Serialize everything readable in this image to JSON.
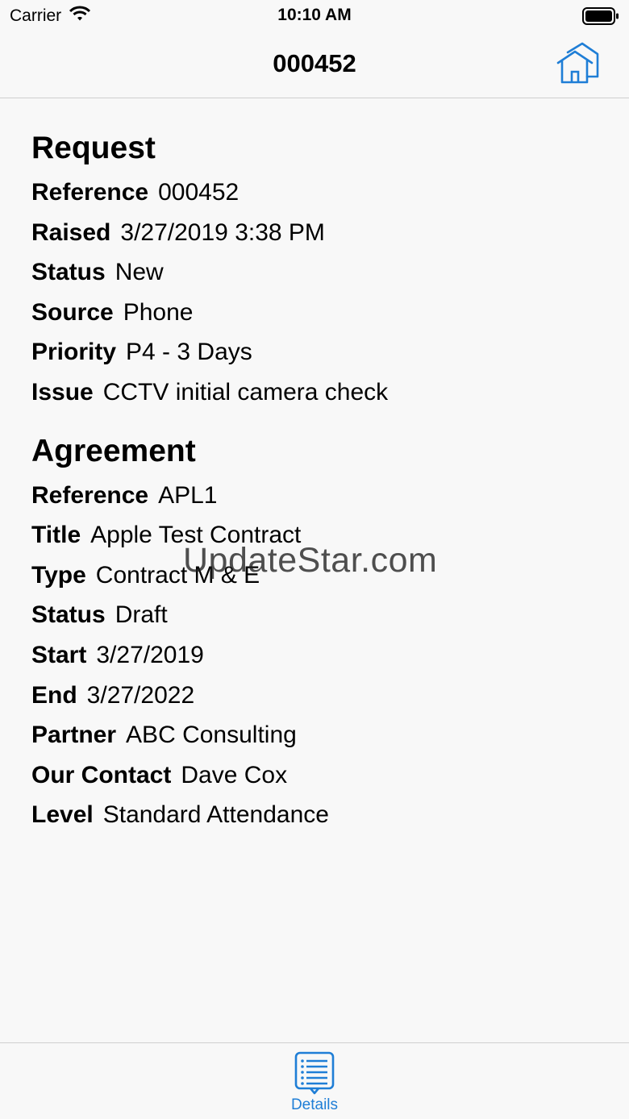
{
  "status_bar": {
    "carrier": "Carrier",
    "time": "10:10 AM"
  },
  "nav": {
    "title": "000452",
    "home_icon": "home-icon"
  },
  "request": {
    "heading": "Request",
    "rows": [
      {
        "label": "Reference",
        "value": "000452"
      },
      {
        "label": "Raised",
        "value": "3/27/2019 3:38 PM"
      },
      {
        "label": "Status",
        "value": "New"
      },
      {
        "label": "Source",
        "value": "Phone"
      },
      {
        "label": "Priority",
        "value": "P4 - 3 Days"
      },
      {
        "label": "Issue",
        "value": "CCTV initial camera check"
      }
    ]
  },
  "agreement": {
    "heading": "Agreement",
    "rows": [
      {
        "label": "Reference",
        "value": "APL1"
      },
      {
        "label": "Title",
        "value": "Apple Test Contract"
      },
      {
        "label": "Type",
        "value": "Contract M & E"
      },
      {
        "label": "Status",
        "value": "Draft"
      },
      {
        "label": "Start",
        "value": "3/27/2019"
      },
      {
        "label": "End",
        "value": "3/27/2022"
      },
      {
        "label": "Partner",
        "value": "ABC Consulting"
      },
      {
        "label": "Our Contact",
        "value": "Dave Cox"
      },
      {
        "label": "Level",
        "value": "Standard Attendance"
      }
    ]
  },
  "watermark": "UpdateStar.com",
  "tab_bar": {
    "tabs": [
      {
        "label": "Details",
        "icon": "list-icon",
        "selected": true
      }
    ]
  },
  "colors": {
    "accent": "#1f7ed6",
    "background": "#f8f8f8",
    "separator": "#cfcfcf"
  }
}
